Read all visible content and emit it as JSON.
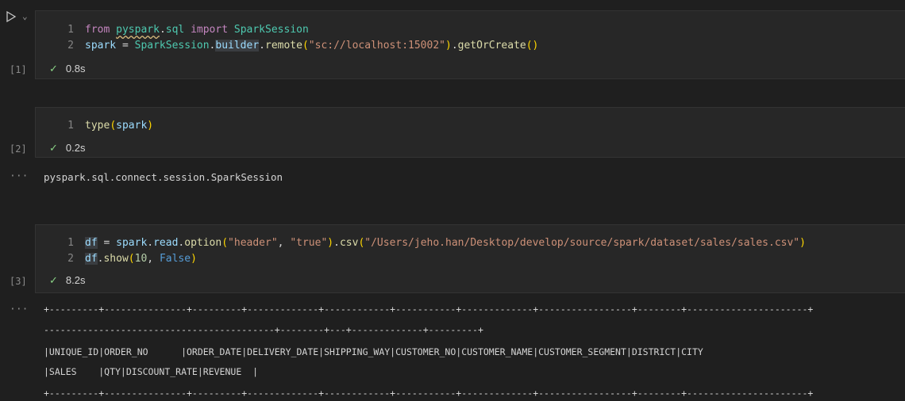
{
  "cells": [
    {
      "exec_count": "[1]",
      "status_time": "0.8s",
      "lines": [
        "1",
        "2"
      ]
    },
    {
      "exec_count": "[2]",
      "status_time": "0.2s",
      "lines": [
        "1"
      ],
      "output": "pyspark.sql.connect.session.SparkSession"
    },
    {
      "exec_count": "[3]",
      "status_time": "8.2s",
      "lines": [
        "1",
        "2"
      ],
      "output_lines": [
        "+---------+---------------+---------+-------------+------------+-----------+-------------+-----------------+--------+----------------------+",
        "------------------------------------------+--------+---+-------------+---------+",
        "|UNIQUE_ID|ORDER_NO      |ORDER_DATE|DELIVERY_DATE|SHIPPING_WAY|CUSTOMER_NO|CUSTOMER_NAME|CUSTOMER_SEGMENT|DISTRICT|CITY",
        "|SALES    |QTY|DISCOUNT_RATE|REVENUE  |",
        "+---------+---------------+---------+-------------+------------+-----------+-------------+-----------------+--------+----------------------+"
      ]
    }
  ],
  "code": {
    "c1_l1": {
      "from": "from",
      "mod1": "pyspark",
      "dot": ".",
      "mod2": "sql",
      "imp": "import",
      "cls": "SparkSession"
    },
    "c1_l2": {
      "var": "spark",
      "eq": " = ",
      "cls": "SparkSession",
      "dot1": ".",
      "builder": "builder",
      "dot2": ".",
      "remote": "remote",
      "p1": "(",
      "str": "\"sc://localhost:15002\"",
      "p2": ")",
      "dot3": ".",
      "goc": "getOrCreate",
      "p3": "()"
    },
    "c2_l1": {
      "fn": "type",
      "p1": "(",
      "var": "spark",
      "p2": ")"
    },
    "c3_l1": {
      "df": "df",
      "eq": " = ",
      "spark": "spark",
      "d1": ".",
      "read": "read",
      "d2": ".",
      "option": "option",
      "p1": "(",
      "s1": "\"header\"",
      "comma": ", ",
      "s2": "\"true\"",
      "p2": ")",
      "d3": ".",
      "csv": "csv",
      "p3": "(",
      "s3": "\"/Users/jeho.han/Desktop/develop/source/spark/dataset/sales/sales.csv\"",
      "p4": ")"
    },
    "c3_l2": {
      "df": "df",
      "d1": ".",
      "show": "show",
      "p1": "(",
      "n": "10",
      "comma": ", ",
      "f": "False",
      "p2": ")"
    }
  },
  "icons": {
    "run": "run-icon",
    "chevron": "chevron-down-icon",
    "check": "check-icon",
    "ellipsis": "output-ellipsis-icon"
  },
  "glyphs": {
    "chevron": "⌄",
    "check": "✓",
    "ellipsis": "···"
  },
  "colors": {
    "check": "#89d185",
    "background": "#1f1f1f",
    "cell": "#272727"
  }
}
